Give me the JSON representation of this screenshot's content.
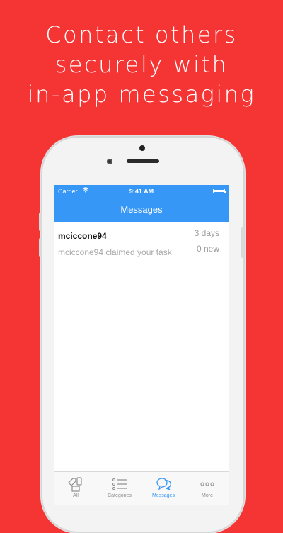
{
  "headline": [
    "Contact others",
    "securely with",
    "in-app messaging"
  ],
  "status_bar": {
    "carrier": "Carrier",
    "time": "9:41 AM"
  },
  "nav": {
    "title": "Messages"
  },
  "messages": [
    {
      "user": "mciccone94",
      "time": "3 days",
      "text": "mciccone94 claimed your task",
      "badge": "0 new"
    }
  ],
  "tabs": [
    {
      "label": "All",
      "icon": "tag-icon"
    },
    {
      "label": "Categories",
      "icon": "list-icon"
    },
    {
      "label": "Messages",
      "icon": "chat-bubbles-icon"
    },
    {
      "label": "More",
      "icon": "more-dots-icon"
    }
  ],
  "colors": {
    "background": "#f53434",
    "accent": "#3797f7"
  }
}
